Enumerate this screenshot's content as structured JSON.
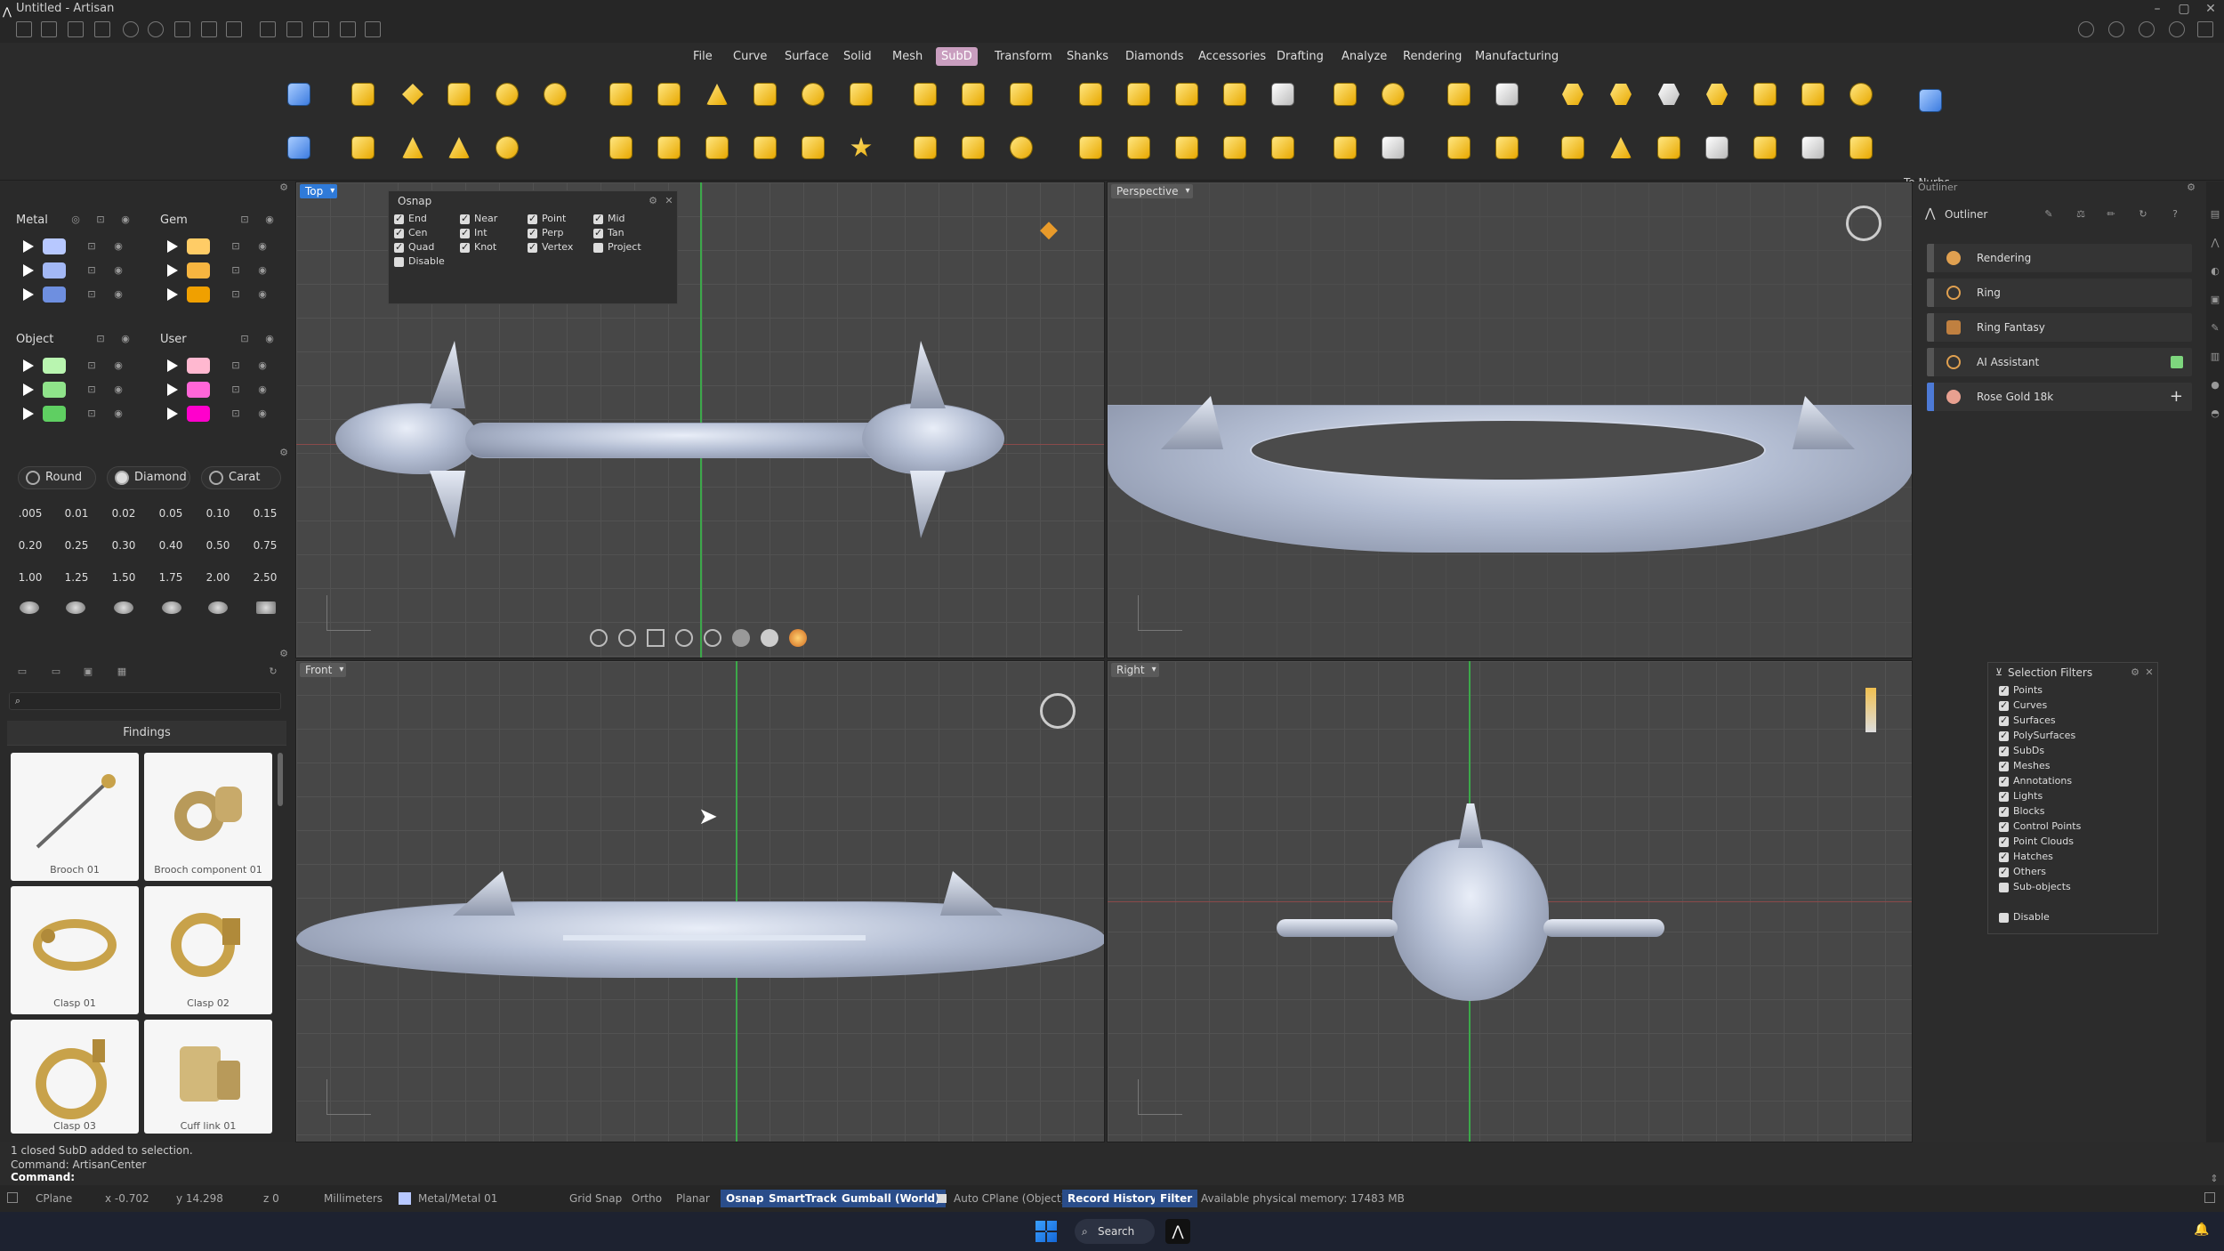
{
  "window": {
    "title": "Untitled - Artisan"
  },
  "menu": [
    {
      "label": "File"
    },
    {
      "label": "Curve"
    },
    {
      "label": "Surface"
    },
    {
      "label": "Solid"
    },
    {
      "label": "Mesh"
    },
    {
      "label": "SubD"
    },
    {
      "label": "Transform"
    },
    {
      "label": "Shanks"
    },
    {
      "label": "Diamonds"
    },
    {
      "label": "Accessories"
    },
    {
      "label": "Drafting"
    },
    {
      "label": "Analyze"
    },
    {
      "label": "Rendering"
    },
    {
      "label": "Manufacturing"
    }
  ],
  "ribbon": {
    "to_nurbs": "To Nurbs"
  },
  "layers": {
    "metal": "Metal",
    "gem": "Gem",
    "object": "Object",
    "user": "User",
    "metal_colors": [
      "#b7c8ff",
      "#a3b8f5",
      "#6e8fe0"
    ],
    "gem_colors": [
      "#ffcc66",
      "#f7b540",
      "#f0a000"
    ],
    "object_colors": [
      "#b9f5b0",
      "#8fe38a",
      "#5fcf62"
    ],
    "user_colors": [
      "#ffb8d0",
      "#ff66d8",
      "#ff00cc"
    ]
  },
  "gems": {
    "shapes": [
      "Round",
      "Diamond",
      "Carat"
    ],
    "sizes": [
      ".005",
      "0.01",
      "0.02",
      "0.05",
      "0.10",
      "0.15",
      "0.20",
      "0.25",
      "0.30",
      "0.40",
      "0.50",
      "0.75",
      "1.00",
      "1.25",
      "1.50",
      "1.75",
      "2.00",
      "2.50"
    ]
  },
  "library": {
    "section": "Findings",
    "items": [
      {
        "label": "Brooch 01"
      },
      {
        "label": "Brooch component 01"
      },
      {
        "label": "Clasp 01"
      },
      {
        "label": "Clasp 02"
      },
      {
        "label": "Clasp 03"
      },
      {
        "label": "Cuff link 01"
      }
    ]
  },
  "viewports": {
    "top": "Top",
    "perspective": "Perspective",
    "front": "Front",
    "right": "Right"
  },
  "osnap": {
    "title": "Osnap",
    "items": [
      {
        "label": "End",
        "checked": true
      },
      {
        "label": "Near",
        "checked": true
      },
      {
        "label": "Point",
        "checked": true
      },
      {
        "label": "Mid",
        "checked": true
      },
      {
        "label": "Cen",
        "checked": true
      },
      {
        "label": "Int",
        "checked": true
      },
      {
        "label": "Perp",
        "checked": true
      },
      {
        "label": "Tan",
        "checked": true
      },
      {
        "label": "Quad",
        "checked": true
      },
      {
        "label": "Knot",
        "checked": true
      },
      {
        "label": "Vertex",
        "checked": true
      },
      {
        "label": "Project",
        "checked": false
      },
      {
        "label": "Disable",
        "checked": false
      }
    ]
  },
  "outliner": {
    "panel_title": "Outliner",
    "tab": "Outliner",
    "items": [
      {
        "label": "Rendering"
      },
      {
        "label": "Ring"
      },
      {
        "label": "Ring Fantasy"
      },
      {
        "label": "AI Assistant"
      },
      {
        "label": "Rose Gold 18k"
      }
    ]
  },
  "selection_filters": {
    "title": "Selection Filters",
    "items": [
      {
        "label": "Points",
        "checked": true
      },
      {
        "label": "Curves",
        "checked": true
      },
      {
        "label": "Surfaces",
        "checked": true
      },
      {
        "label": "PolySurfaces",
        "checked": true
      },
      {
        "label": "SubDs",
        "checked": true
      },
      {
        "label": "Meshes",
        "checked": true
      },
      {
        "label": "Annotations",
        "checked": true
      },
      {
        "label": "Lights",
        "checked": true
      },
      {
        "label": "Blocks",
        "checked": true
      },
      {
        "label": "Control Points",
        "checked": true
      },
      {
        "label": "Point Clouds",
        "checked": true
      },
      {
        "label": "Hatches",
        "checked": true
      },
      {
        "label": "Others",
        "checked": true
      },
      {
        "label": "Sub-objects",
        "checked": false
      }
    ],
    "disable": "Disable"
  },
  "command": {
    "history1": "1 closed SubD added to selection.",
    "history2": "Command: ArtisanCenter",
    "prompt": "Command:"
  },
  "statusbar": {
    "cplane": "CPlane",
    "x": "x -0.702",
    "y": "y 14.298",
    "z": "z 0",
    "units": "Millimeters",
    "layer": "Metal/Metal 01",
    "grid_snap": "Grid Snap",
    "ortho": "Ortho",
    "planar": "Planar",
    "osnap": "Osnap",
    "smarttrack": "SmartTrack",
    "gumball": "Gumball (World)",
    "auto_cplane": "Auto CPlane (Object)",
    "record_history": "Record History",
    "filter": "Filter",
    "memory": "Available physical memory: 17483 MB"
  },
  "taskbar": {
    "search": "Search"
  }
}
